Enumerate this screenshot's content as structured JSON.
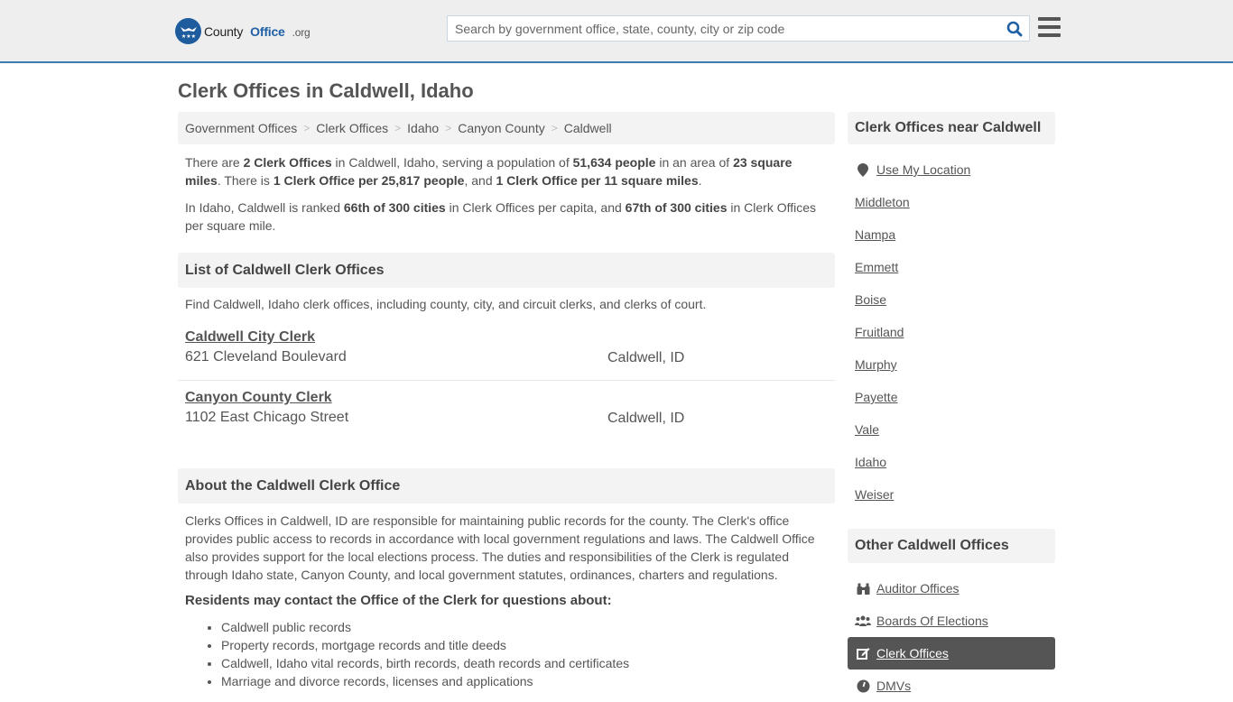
{
  "header": {
    "logo_county": "County",
    "logo_office": "Office",
    "logo_tld": ".org",
    "search_placeholder": "Search by government office, state, county, city or zip code",
    "search_value": "",
    "accent_color": "#1f5fa6"
  },
  "page_title": "Clerk Offices in Caldwell, Idaho",
  "breadcrumb": [
    "Government Offices",
    "Clerk Offices",
    "Idaho",
    "Canyon County",
    "Caldwell"
  ],
  "summary": {
    "p1": [
      "There are ",
      "2 Clerk Offices",
      " in Caldwell, Idaho, serving a population of ",
      "51,634 people",
      " in an area of ",
      "23 square miles",
      ". There is ",
      "1 Clerk Office per 25,817 people",
      ", and ",
      "1 Clerk Office per 11 square miles",
      "."
    ],
    "p2": [
      "In Idaho, Caldwell is ranked ",
      "66th of 300 cities",
      " in Clerk Offices per capita, and ",
      "67th of 300 cities",
      " in Clerk Offices per square mile."
    ]
  },
  "list": {
    "heading": "List of Caldwell Clerk Offices",
    "intro": "Find Caldwell, Idaho clerk offices, including county, city, and circuit clerks, and clerks of court.",
    "offices": [
      {
        "name": "Caldwell City Clerk",
        "address": "621 Cleveland Boulevard",
        "city": "Caldwell, ID"
      },
      {
        "name": "Canyon County Clerk",
        "address": "1102 East Chicago Street",
        "city": "Caldwell, ID"
      }
    ]
  },
  "about": {
    "heading": "About the Caldwell Clerk Office",
    "text": "Clerks Offices in Caldwell, ID are responsible for maintaining public records for the county. The Clerk's office provides public access to records in accordance with local government regulations and laws. The Caldwell Office also provides support for the local elections process. The duties and responsibilities of the Clerk is regulated through Idaho state, Canyon County, and local government statutes, ordinances, charters and regulations.",
    "residents_heading": "Residents may contact the Office of the Clerk for questions about:",
    "bullets": [
      "Caldwell public records",
      "Property records, mortgage records and title deeds",
      "Caldwell, Idaho vital records, birth records, death records and certificates",
      "Marriage and divorce records, licenses and applications"
    ]
  },
  "sidebar": {
    "near_heading": "Clerk Offices near Caldwell",
    "use_location": "Use My Location",
    "near": [
      "Middleton",
      "Nampa",
      "Emmett",
      "Boise",
      "Fruitland",
      "Murphy",
      "Payette",
      "Vale",
      "Idaho",
      "Weiser"
    ],
    "other_heading": "Other Caldwell Offices",
    "other": [
      {
        "label": "Auditor Offices",
        "icon": "binoculars-icon"
      },
      {
        "label": "Boards Of Elections",
        "icon": "users-icon"
      },
      {
        "label": "Clerk Offices",
        "icon": "edit-icon",
        "active": true
      },
      {
        "label": "DMVs",
        "icon": "dashboard-icon"
      }
    ]
  }
}
